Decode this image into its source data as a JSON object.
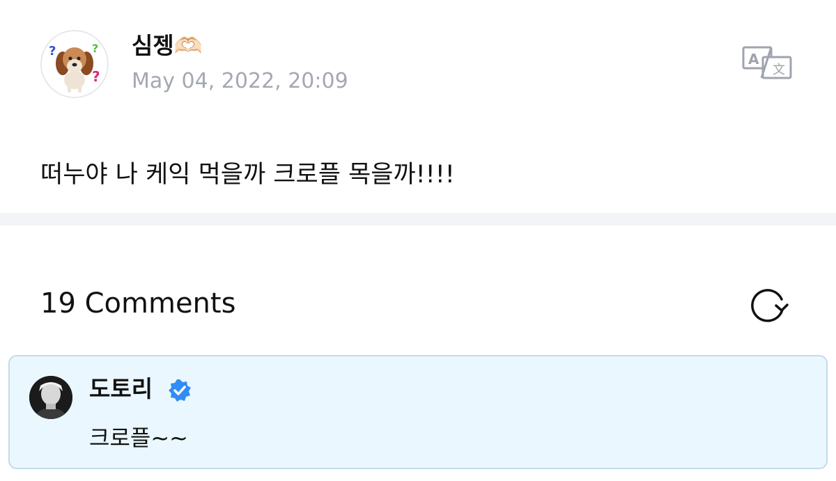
{
  "post": {
    "author": "심젱🫶🏻",
    "timestamp": "May 04, 2022, 20:09",
    "body": "떠누야 나 케익 먹을까 크로플 목을까!!!!",
    "avatar_icon": "dog-avatar-icon",
    "translate_icon": "translate-icon"
  },
  "comments": {
    "count_label": "19 Comments",
    "refresh_icon": "refresh-icon",
    "items": [
      {
        "author": "도토리",
        "verified": true,
        "text": "크로플~~",
        "highlight_color": "#eaf7fe"
      }
    ]
  },
  "colors": {
    "timestamp": "#a4a8b2",
    "verified_badge": "#2f8df5",
    "divider": "#f3f4f8",
    "comment_border": "#c3dce8"
  }
}
